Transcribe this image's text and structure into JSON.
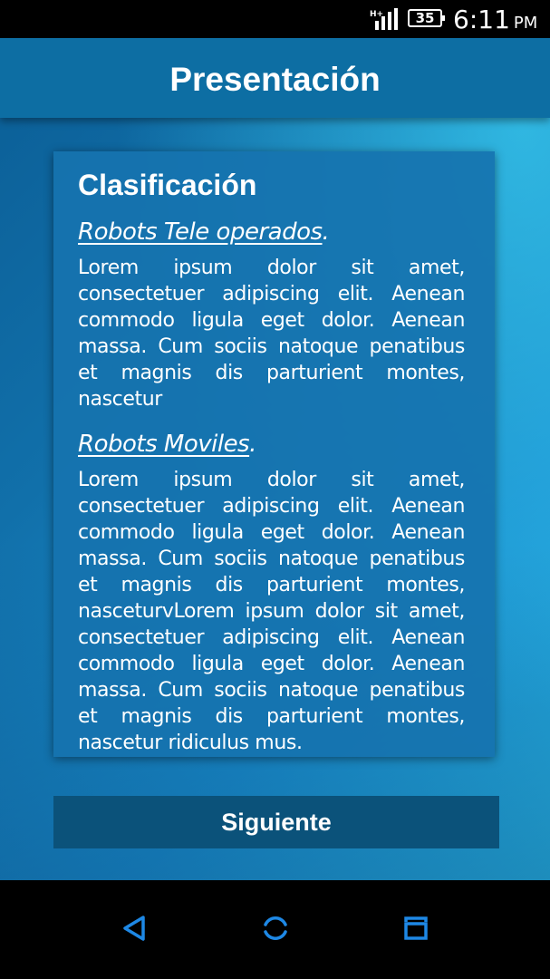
{
  "status_bar": {
    "network": "H+",
    "battery": "35",
    "time": "6:11",
    "ampm": "PM"
  },
  "header": {
    "title": "Presentación"
  },
  "card": {
    "title": "Clasificación",
    "sections": [
      {
        "heading": "Robots Tele operados",
        "heading_suffix": ".",
        "body": "Lorem ipsum dolor sit amet, consectetuer adipiscing elit. Aenean commodo ligula eget dolor. Aenean massa. Cum sociis natoque penatibus et magnis dis parturient montes, nascetur"
      },
      {
        "heading": "Robots Moviles",
        "heading_suffix": ".",
        "body": "Lorem ipsum dolor sit amet, consectetuer adipiscing elit. Aenean commodo ligula eget dolor. Aenean massa. Cum sociis natoque penatibus et magnis dis parturient montes, nasceturvLorem ipsum dolor sit amet, consectetuer adipiscing elit. Aenean commodo ligula eget dolor. Aenean massa. Cum sociis natoque penatibus et magnis dis parturient montes, nascetur ridiculus mus."
      }
    ]
  },
  "next_button": {
    "label": "Siguiente"
  },
  "nav_bar": {
    "icons": [
      "back-icon",
      "home-icon",
      "recent-apps-icon"
    ],
    "accent_color": "#1e88e5"
  },
  "colors": {
    "header": "#0d6ea3",
    "card": "#1673af",
    "button": "#0b527a",
    "text": "#ffffff"
  }
}
